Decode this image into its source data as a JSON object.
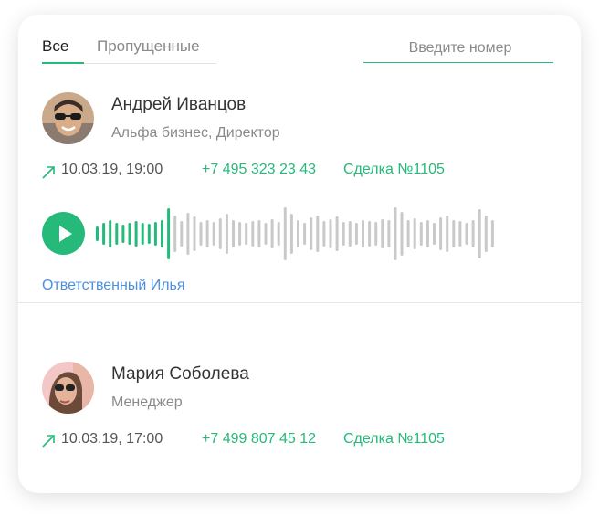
{
  "tabs": [
    {
      "label": "Все",
      "active": true
    },
    {
      "label": "Пропущенные",
      "active": false
    }
  ],
  "search": {
    "placeholder": "Введите номер"
  },
  "calls": [
    {
      "name": "Андрей Иванцов",
      "role": "Альфа бизнес, Директор",
      "direction_icon": "arrow-up-right-icon",
      "date": "10.03.19, 19:00",
      "phone": "+7 495 323 23 43",
      "deal": "Сделка №1105",
      "recording": {
        "played_fraction": 0.2
      },
      "responsible": "Ответственный Илья"
    },
    {
      "name": "Мария Соболева",
      "role": "Менеджер",
      "direction_icon": "arrow-up-right-icon",
      "date": "10.03.19, 17:00",
      "phone": "+7 499 807 45 12",
      "deal": "Сделка №1105"
    }
  ],
  "colors": {
    "accent": "#25b97a",
    "link": "#4a90e2",
    "wave_inactive": "#c9c9c9"
  }
}
